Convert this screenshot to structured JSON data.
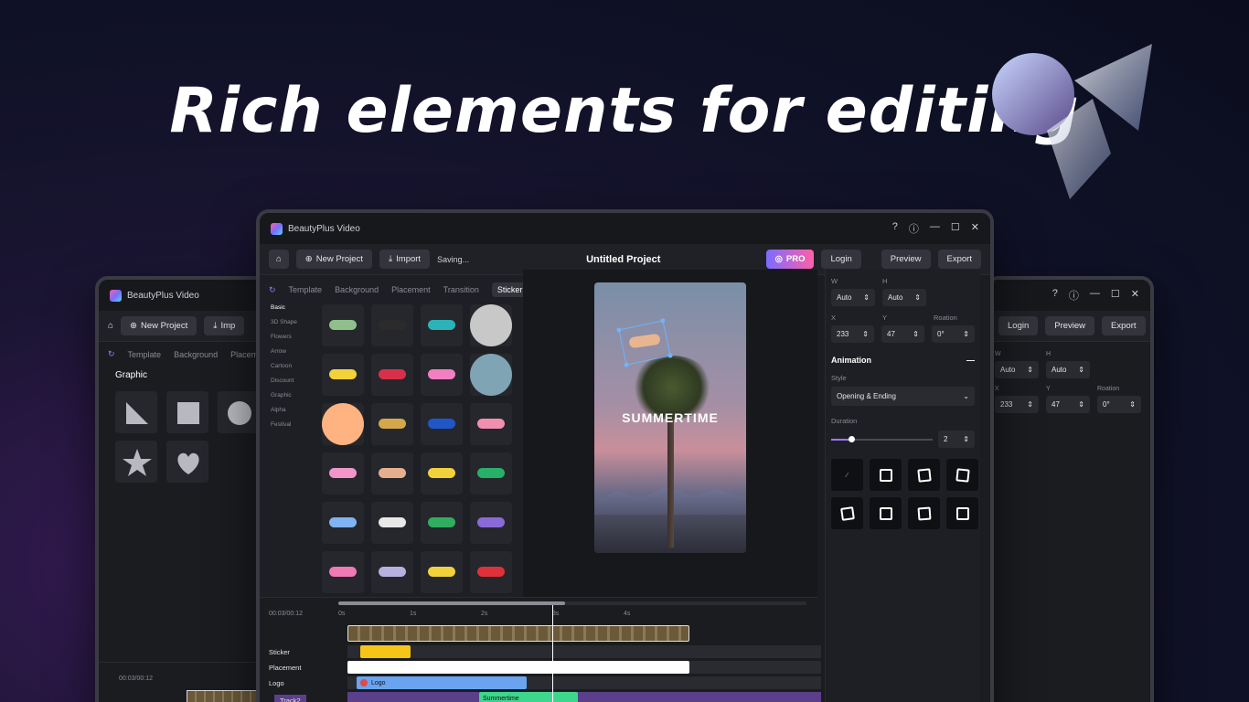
{
  "hero_title": "Rich elements for editing",
  "app_name": "BeautyPlus Video",
  "toolbar": {
    "new_project": "New Project",
    "import": "Import",
    "import_short": "Imp",
    "status": "Saving...",
    "project_title": "Untitled Project",
    "pro": "PRO",
    "login": "Login",
    "preview": "Preview",
    "export": "Export"
  },
  "tabs": [
    "Template",
    "Background",
    "Placement",
    "Transition",
    "Sticker"
  ],
  "left_tabs": [
    "Template",
    "Background",
    "Placem"
  ],
  "left_panel_title": "Graphic",
  "categories": [
    "Basic",
    "3D Shape",
    "Flowers",
    "Arrow",
    "Cartoon",
    "Discount",
    "Graphic",
    "Alpha",
    "Festival"
  ],
  "canvas_text": "SUMMERTIME",
  "properties": {
    "w_label": "W",
    "w_value": "Auto",
    "h_label": "H",
    "h_value": "Auto",
    "x_label": "X",
    "x_value": "233",
    "y_label": "Y",
    "y_value": "47",
    "rot_label": "Roation",
    "rot_value": "0°"
  },
  "animation": {
    "title": "Animation",
    "style_label": "Style",
    "style_value": "Opening & Ending",
    "duration_label": "Duration",
    "duration_value": "2",
    "duration_fraction": 0.2
  },
  "timeline": {
    "time": "00:03/00:12",
    "ticks": [
      "0s",
      "1s",
      "2s",
      "3s",
      "4s"
    ],
    "tracks": [
      "Sticker",
      "Placement",
      "Logo",
      "Track2"
    ],
    "logo_clip": "Logo",
    "summer_clip": "Summertime"
  },
  "colors": {
    "accent": "#9a7aff",
    "sticker_clip": "#f5c518",
    "logo_clip": "#6aa4f0",
    "summer_clip": "#3dd68c",
    "track2_bg": "#5a3f8a"
  },
  "sticker_colors": [
    "#8fbf8a",
    "#2b2b2b",
    "#2bb3b8",
    "#c8c8c8",
    "#f2d23a",
    "#d8304a",
    "#f27fc1",
    "#7fa4b3",
    "#ffb380",
    "#d4a84a",
    "#2156c8",
    "#f08fb0",
    "#f295c8",
    "#e6b08f",
    "#f2d23a",
    "#27b067",
    "#7fb3f2",
    "#e8e8e8",
    "#2fae5f",
    "#8a6ad8",
    "#f07ab3",
    "#b8b0e0",
    "#f2d23a",
    "#e0303a"
  ]
}
